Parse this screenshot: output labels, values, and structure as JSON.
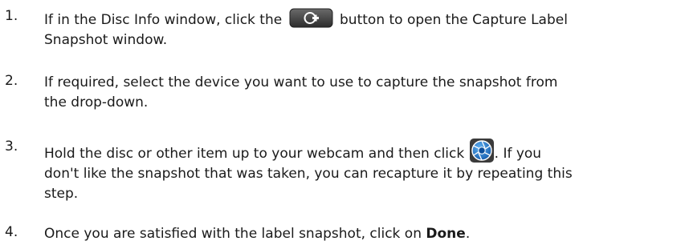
{
  "steps": [
    {
      "number": "1.",
      "line1_before": "If in the Disc Info window, click the",
      "line1_after": "button to open the Capture Label",
      "line2": "Snapshot window.",
      "icon": "capture-label-icon"
    },
    {
      "number": "2.",
      "line1": "If required, select the device you want to use to capture the snapshot from",
      "line2": "the drop-down."
    },
    {
      "number": "3.",
      "line1_before": "Hold the disc or other item up to your webcam and then click",
      "line1_after": ". If you",
      "line2": "don't like the snapshot that was taken, you can recapture it by repeating this",
      "line3": "step.",
      "icon": "camera-shutter-icon"
    },
    {
      "number": "4.",
      "line1_before": "Once you are satisfied with the label snapshot, click on",
      "bold": "Done",
      "line1_after": "."
    }
  ],
  "colors": {
    "text": "#1a1a1a",
    "button_dark": "#4a4a4a",
    "shutter_blue": "#1e74c4"
  }
}
